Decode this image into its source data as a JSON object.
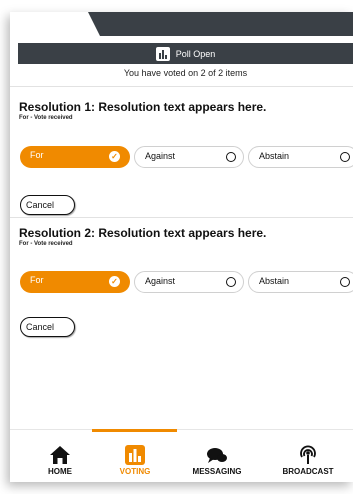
{
  "poll": {
    "status": "Poll Open",
    "voted_summary": "You have voted on 2 of 2 items"
  },
  "resolutions": [
    {
      "title": "Resolution 1: Resolution text appears here.",
      "status": "For - Vote received",
      "options": [
        "For",
        "Against",
        "Abstain"
      ],
      "selected": "For",
      "cancel_label": "Cancel"
    },
    {
      "title": "Resolution 2: Resolution text appears here.",
      "status": "For - Vote received",
      "options": [
        "For",
        "Against",
        "Abstain"
      ],
      "selected": "For",
      "cancel_label": "Cancel"
    }
  ],
  "nav": {
    "items": [
      {
        "label": "HOME",
        "icon": "home-icon"
      },
      {
        "label": "VOTING",
        "icon": "voting-icon"
      },
      {
        "label": "MESSAGING",
        "icon": "messaging-icon"
      },
      {
        "label": "BROADCAST",
        "icon": "broadcast-icon"
      }
    ],
    "active": "VOTING"
  },
  "colors": {
    "accent": "#f08a00",
    "header_bar": "#3a4046"
  }
}
